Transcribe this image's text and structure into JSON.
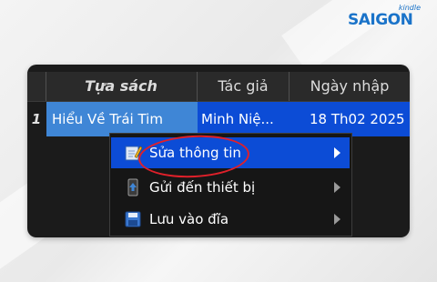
{
  "logo": {
    "text": "SAIGON",
    "small": "kindle"
  },
  "table": {
    "columns": [
      "Tựa sách",
      "Tác giả",
      "Ngày nhập"
    ],
    "rows": [
      {
        "num": "1",
        "title": "Hiểu Về Trái Tim",
        "author": "Minh Niệ...",
        "date": "18 Th02 2025"
      }
    ]
  },
  "context_menu": {
    "items": [
      {
        "label": "Sửa thông tin",
        "icon": "edit-icon",
        "selected": true
      },
      {
        "label": "Gửi đến thiết bị",
        "icon": "send-device-icon",
        "selected": false
      },
      {
        "label": "Lưu vào đĩa",
        "icon": "save-disk-icon",
        "selected": false
      }
    ]
  },
  "colors": {
    "selection": "#0c4cd6",
    "title_cell": "#3f86d6",
    "annotation": "#e0202a",
    "window_bg": "#1b1b1b"
  }
}
